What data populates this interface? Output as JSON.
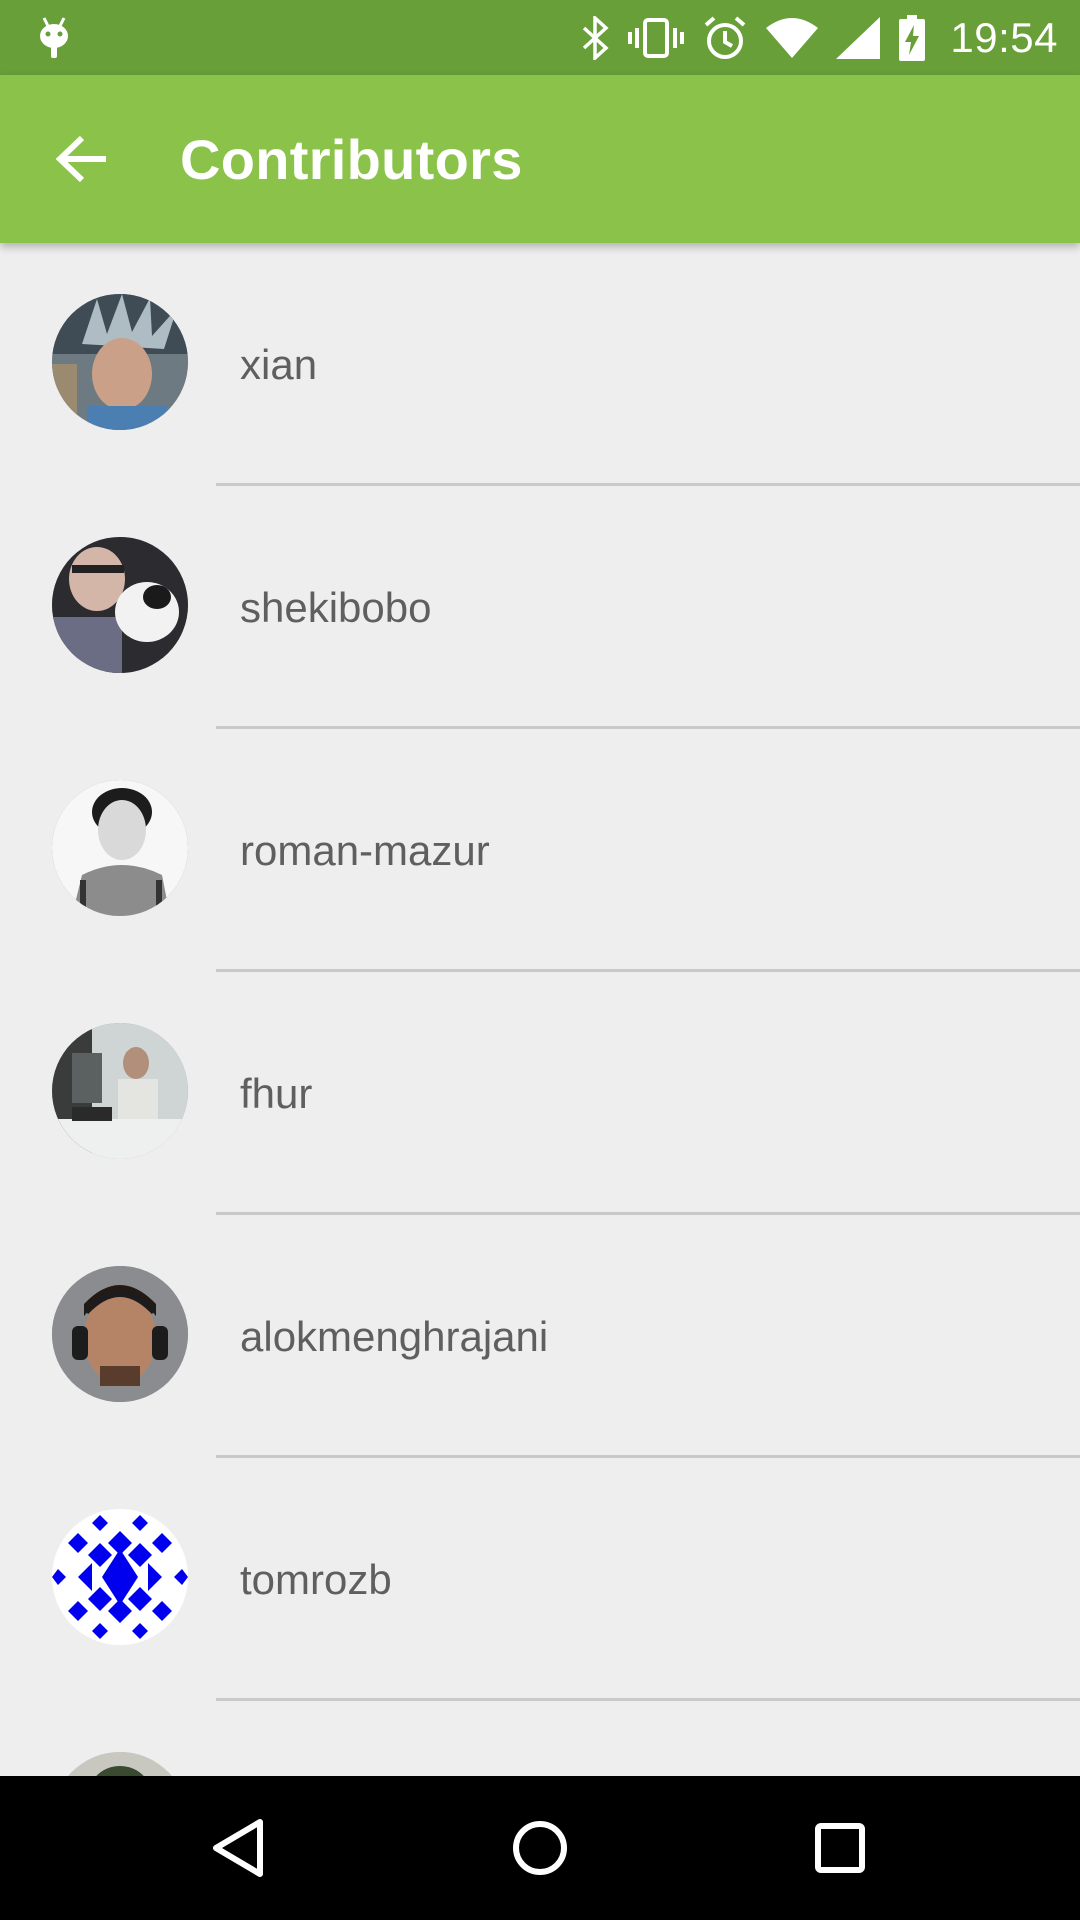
{
  "status_bar": {
    "time": "19:54",
    "icons": [
      "android-debug-icon",
      "bluetooth-icon",
      "vibrate-icon",
      "alarm-icon",
      "wifi-icon",
      "signal-icon",
      "battery-charging-icon"
    ]
  },
  "app_bar": {
    "back_icon": "arrow-back-icon",
    "title": "Contributors"
  },
  "contributors": [
    {
      "name": "xian"
    },
    {
      "name": "shekibobo"
    },
    {
      "name": "roman-mazur"
    },
    {
      "name": "fhur"
    },
    {
      "name": "alokmenghrajani"
    },
    {
      "name": "tomrozb"
    }
  ],
  "nav_bar": {
    "icons": [
      "nav-back-icon",
      "nav-home-icon",
      "nav-recents-icon"
    ]
  },
  "colors": {
    "status_bar": "#689f38",
    "app_bar": "#8bc34a",
    "list_background": "#eeeeee",
    "name_text": "#5f5f5f",
    "divider": "#c9c9c9",
    "identicon_blue": "#0000ee"
  }
}
